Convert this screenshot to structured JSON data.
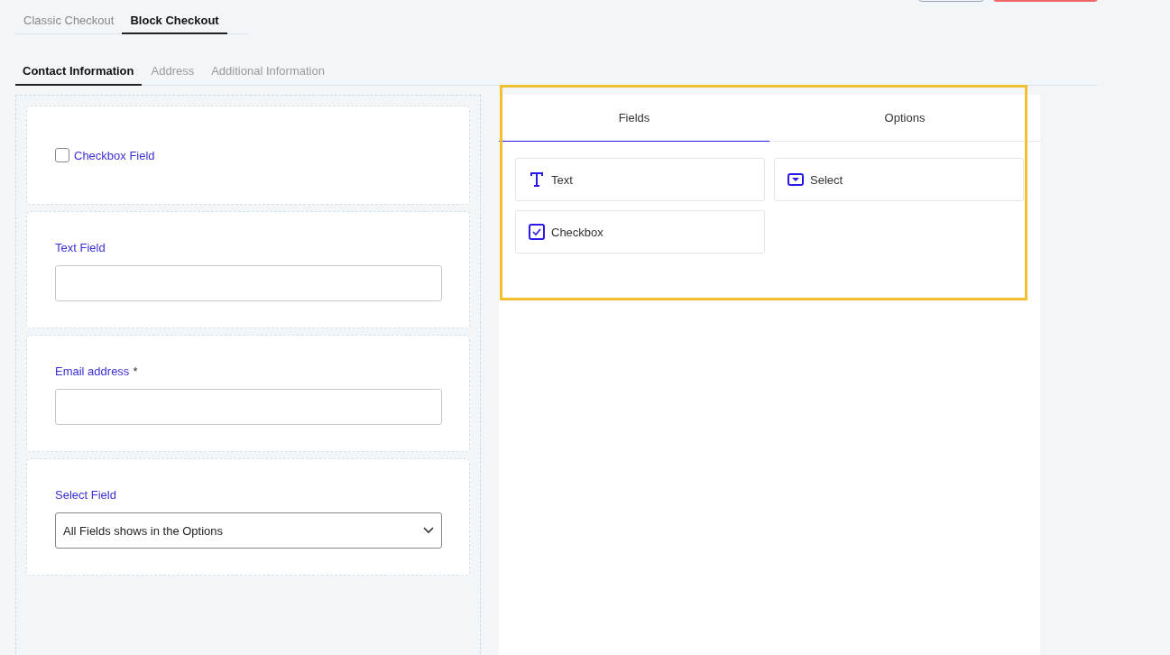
{
  "checkout_tabs": [
    {
      "label": "Classic Checkout",
      "selected": false
    },
    {
      "label": "Block Checkout",
      "selected": true
    }
  ],
  "section_tabs": [
    {
      "label": "Contact Information",
      "selected": true
    },
    {
      "label": "Address",
      "selected": false
    },
    {
      "label": "Additional Information",
      "selected": false
    }
  ],
  "form_fields": [
    {
      "kind": "checkbox",
      "label": "Checkbox Field",
      "checked": false
    },
    {
      "kind": "text",
      "label": "Text Field"
    },
    {
      "kind": "text",
      "label": "Email address",
      "required_mark": "*"
    },
    {
      "kind": "select",
      "label": "Select Field",
      "value": "All Fields shows in the Options"
    }
  ],
  "panel_tabs": [
    {
      "label": "Fields",
      "selected": true
    },
    {
      "label": "Options",
      "selected": false
    }
  ],
  "field_types": [
    {
      "kind": "text",
      "label": "Text"
    },
    {
      "kind": "select",
      "label": "Select"
    },
    {
      "kind": "checkbox",
      "label": "Checkbox"
    }
  ]
}
